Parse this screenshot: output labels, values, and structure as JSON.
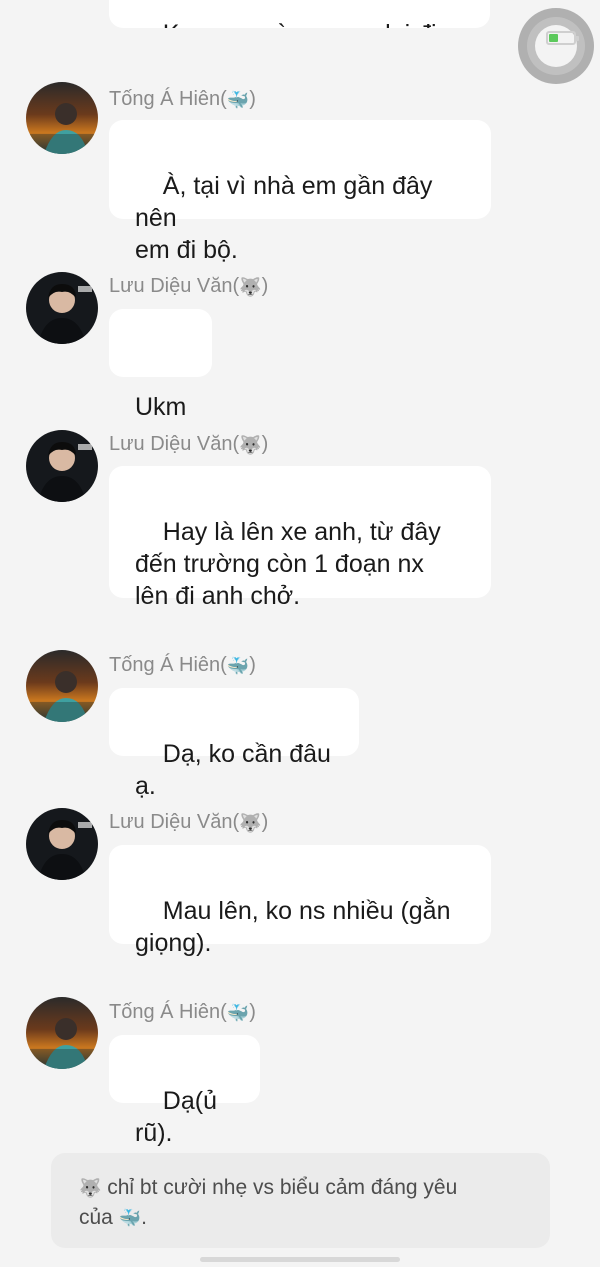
{
  "chat": {
    "top_partial_message": "Ko sao, mà sao em lại đi bộ.",
    "messages": [
      {
        "sender": "Tống Á Hiên",
        "sender_emoji": "🐳",
        "text": "À, tại vì nhà em gần đây nên\nem đi bộ."
      },
      {
        "sender": "Lưu Diệu Văn",
        "sender_emoji": "🐺",
        "text": "Ukm"
      },
      {
        "sender": "Lưu Diệu Văn",
        "sender_emoji": "🐺",
        "text": "Hay là lên xe anh, từ đây\nđến trường còn 1 đoạn nx\nlên đi anh chở."
      },
      {
        "sender": "Tống Á Hiên",
        "sender_emoji": "🐳",
        "text": "Dạ, ko cần đâu ạ."
      },
      {
        "sender": "Lưu Diệu Văn",
        "sender_emoji": "🐺",
        "text": "Mau lên, ko ns nhiều (gằn\ngiọng)."
      },
      {
        "sender": "Tống Á Hiên",
        "sender_emoji": "🐳",
        "text": "Dạ(ủ rũ)."
      }
    ]
  },
  "note": {
    "emoji_start": "🐺",
    "text_line1": " chỉ bt cười nhẹ vs biểu cảm đáng yêu",
    "text_line2": "của ",
    "emoji_end": "🐳",
    "text_end": "."
  },
  "icons": {
    "assistive_touch": "assistive-touch-icon",
    "battery": "battery-icon"
  },
  "colors": {
    "background": "#f4f4f4",
    "bubble": "#ffffff",
    "name_text": "#8a8a8a",
    "note_background": "#ebebeb"
  }
}
